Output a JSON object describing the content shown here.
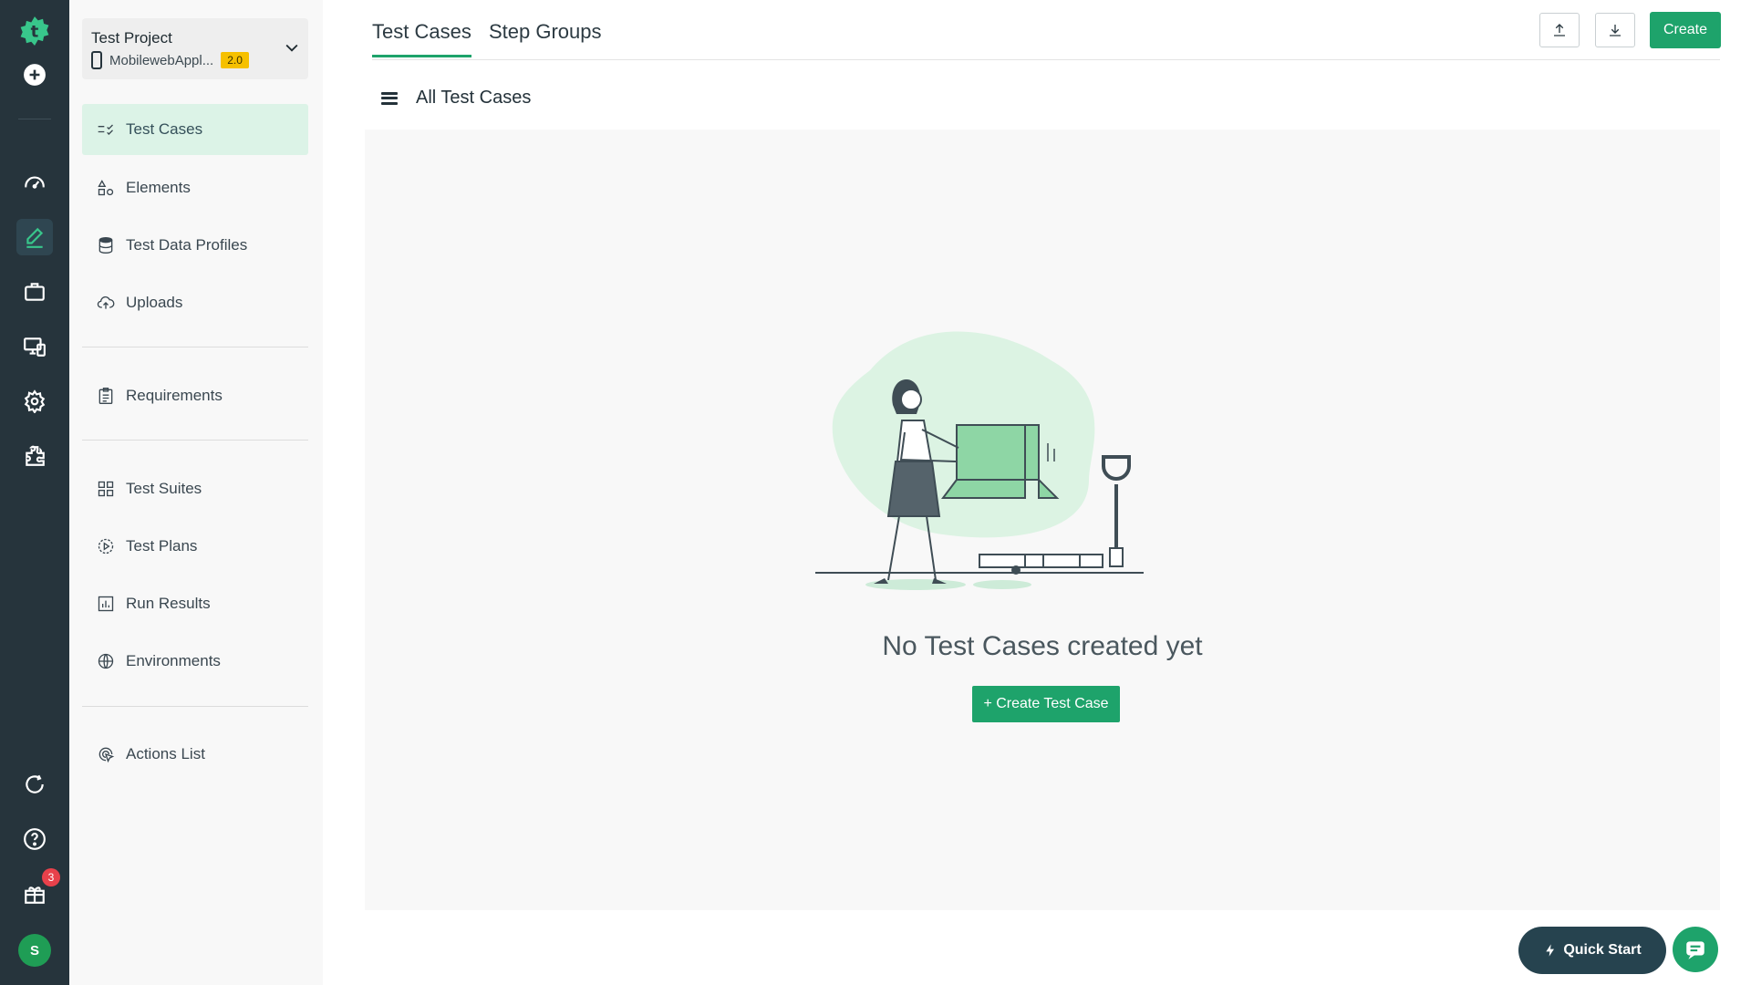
{
  "project": {
    "name": "Test Project",
    "app": "MobilewebAppl...",
    "version": "2.0"
  },
  "nav": {
    "items": [
      {
        "label": "Test Cases"
      },
      {
        "label": "Elements"
      },
      {
        "label": "Test Data Profiles"
      },
      {
        "label": "Uploads"
      },
      {
        "label": "Requirements"
      },
      {
        "label": "Test Suites"
      },
      {
        "label": "Test Plans"
      },
      {
        "label": "Run Results"
      },
      {
        "label": "Environments"
      },
      {
        "label": "Actions List"
      }
    ]
  },
  "tabs": [
    {
      "label": "Test Cases"
    },
    {
      "label": "Step Groups"
    }
  ],
  "toolbar": {
    "create_label": "Create"
  },
  "list": {
    "title": "All Test Cases"
  },
  "empty": {
    "message": "No Test Cases created yet",
    "button_label": "+ Create Test Case"
  },
  "notifications": {
    "count": "3"
  },
  "user": {
    "initial": "S"
  },
  "floating": {
    "quick_start_label": "Quick Start"
  },
  "colors": {
    "rail": "#26343c",
    "accent": "#1ea36b",
    "active_nav": "#dcf3e7",
    "badge": "#e8414b"
  },
  "icons": {
    "rail": [
      "logo-icon",
      "add-icon",
      "dashboard-icon",
      "edit-icon",
      "briefcase-icon",
      "devices-icon",
      "settings-icon",
      "addons-icon",
      "refresh-icon",
      "help-icon",
      "gift-icon"
    ]
  }
}
